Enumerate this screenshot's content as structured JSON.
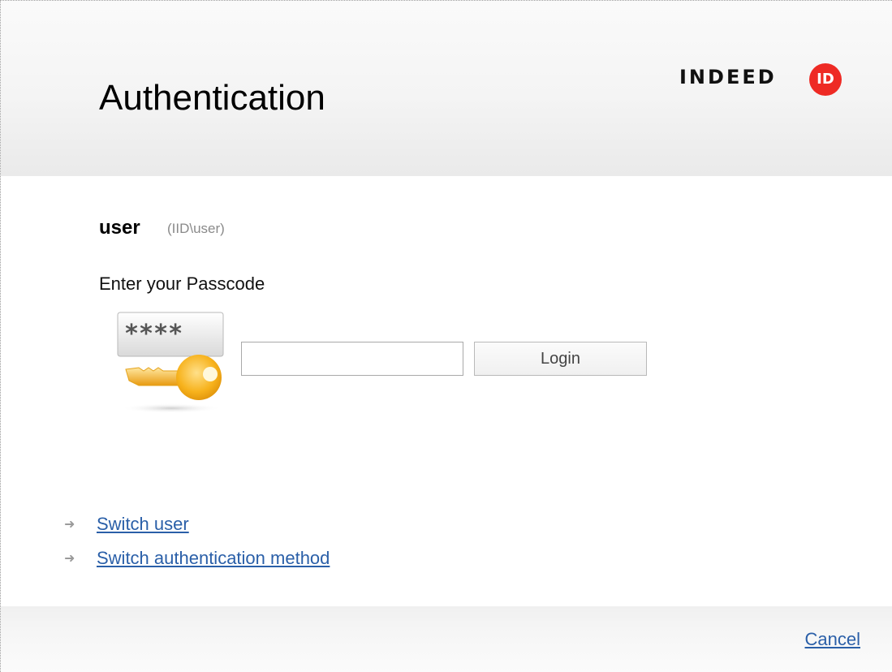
{
  "header": {
    "title": "Authentication",
    "logo_text": "INDEED",
    "logo_badge": "ID",
    "logo_badge_color": "#ee2a24"
  },
  "user": {
    "name": "user",
    "domain": "(IID\\user)"
  },
  "form": {
    "prompt": "Enter your Passcode",
    "passcode_value": "",
    "passcode_placeholder": "",
    "login_label": "Login",
    "key_graphic_text": "****"
  },
  "links": {
    "switch_user": "Switch user",
    "switch_method": "Switch authentication method",
    "link_color": "#2a5fa8"
  },
  "footer": {
    "cancel_label": "Cancel"
  },
  "icons": {
    "arrow": "arrow-right-icon",
    "key": "key-icon",
    "logo": "indeed-id-logo"
  }
}
